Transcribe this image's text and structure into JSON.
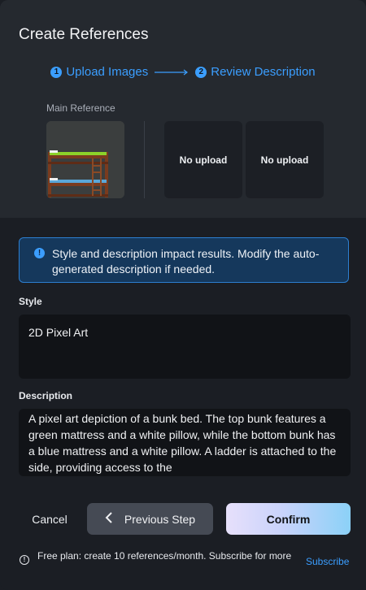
{
  "dialog": {
    "title": "Create References",
    "steps": [
      {
        "number": "1",
        "label": "Upload Images"
      },
      {
        "number": "2",
        "label": "Review Description"
      }
    ],
    "step_arrow_icon": "arrow-right-long-icon"
  },
  "references": {
    "main_label": "Main Reference",
    "main_image_icon": "bunk-bed-pixel-art-thumbnail",
    "slots": [
      {
        "label": "No upload"
      },
      {
        "label": "No upload"
      }
    ]
  },
  "info": {
    "icon": "info-icon",
    "text": "Style and description impact results. Modify the auto-generated description if needed."
  },
  "style": {
    "label": "Style",
    "value": "2D Pixel Art"
  },
  "description": {
    "label": "Description",
    "value": "A pixel art depiction of a bunk bed. The top bunk features a green mattress and a white pillow, while the bottom bunk has a blue mattress and a white pillow. A ladder is attached to the side, providing access to the"
  },
  "actions": {
    "cancel": "Cancel",
    "previous": "Previous Step",
    "confirm": "Confirm"
  },
  "footer": {
    "text": "Free plan: create 10 references/month. Subscribe for more",
    "link": "Subscribe"
  },
  "colors": {
    "accent": "#3b9eff",
    "info_bg": "#15385c",
    "info_border": "#2d7fd0",
    "mattress_top": "#8cd22a",
    "mattress_bottom": "#5aa7d8",
    "wood": "#7a3b1e"
  }
}
